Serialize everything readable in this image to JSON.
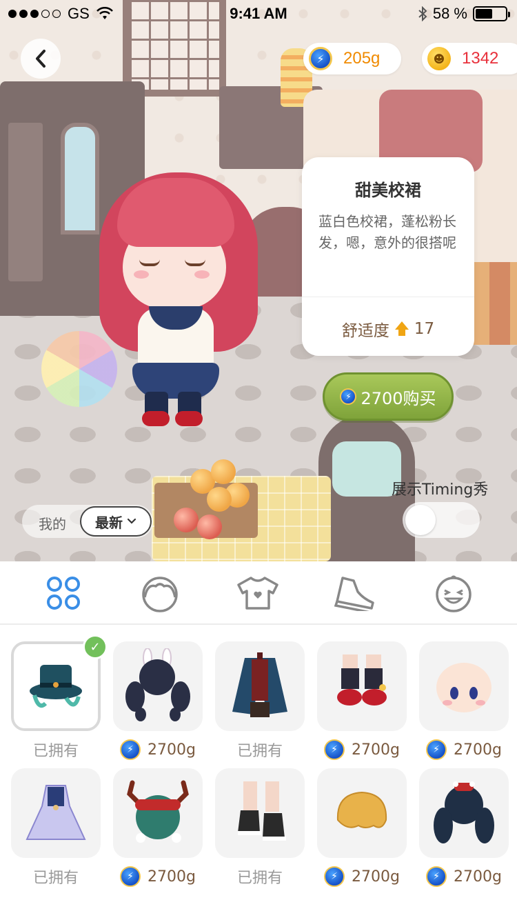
{
  "status_bar": {
    "carrier": "GS",
    "time": "9:41 AM",
    "battery": "58 %",
    "battery_level": 0.58
  },
  "currency": {
    "energy": "205g",
    "hearts": "1342"
  },
  "item_card": {
    "title": "甜美校裙",
    "description": "蓝白色校裙，蓬松粉长发，嗯，意外的很搭呢",
    "comfort_label": "舒适度",
    "comfort_value": "17"
  },
  "buy_button": {
    "label": "2700购买"
  },
  "show_toggle": {
    "label": "展示Timing秀",
    "on": false
  },
  "filter": {
    "mine": "我的",
    "sort": "最新"
  },
  "tabs": [
    {
      "name": "all",
      "icon": "grid-icon",
      "active": true
    },
    {
      "name": "face",
      "icon": "face-icon",
      "active": false
    },
    {
      "name": "clothes",
      "icon": "tshirt-icon",
      "active": false
    },
    {
      "name": "shoes",
      "icon": "sneaker-icon",
      "active": false
    },
    {
      "name": "expression",
      "icon": "laugh-icon",
      "active": false
    }
  ],
  "items": [
    {
      "name": "top-hat",
      "label": "已拥有",
      "owned": true,
      "selected": true
    },
    {
      "name": "bunny-pigtails",
      "label": "2700g",
      "owned": false
    },
    {
      "name": "pirate-coat",
      "label": "已拥有",
      "owned": true
    },
    {
      "name": "red-shoes",
      "label": "2700g",
      "owned": false
    },
    {
      "name": "blush-face",
      "label": "2700g",
      "owned": false
    },
    {
      "name": "lilac-dress",
      "label": "已拥有",
      "owned": true
    },
    {
      "name": "antler-hair",
      "label": "2700g",
      "owned": false
    },
    {
      "name": "sneakers",
      "label": "已拥有",
      "owned": true
    },
    {
      "name": "blonde-bob",
      "label": "2700g",
      "owned": false
    },
    {
      "name": "dark-curls",
      "label": "2700g",
      "owned": false
    }
  ],
  "colors": {
    "accent_blue": "#3a8ee6",
    "buy_green": "#8fb148",
    "owned_grey": "#999999",
    "price_brown": "#7a5a3f",
    "check_green": "#72c05b"
  }
}
